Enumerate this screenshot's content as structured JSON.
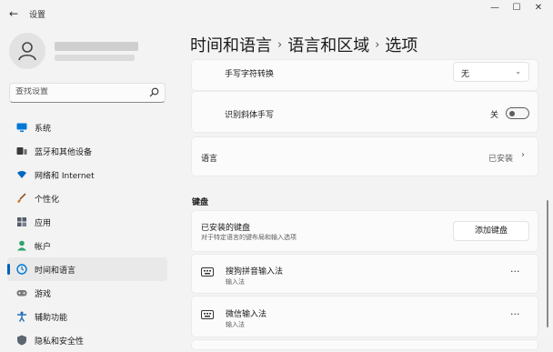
{
  "window": {
    "title": "设置",
    "back_icon": "back-arrow-icon",
    "controls": {
      "minimize": "—",
      "maximize": "☐",
      "close": "✕"
    }
  },
  "search": {
    "placeholder": "查找设置"
  },
  "nav": {
    "items": [
      {
        "label": "系统",
        "icon": "monitor-icon",
        "color": "#0078d4"
      },
      {
        "label": "蓝牙和其他设备",
        "icon": "bluetooth-devices-icon",
        "color": "#3a3a3a"
      },
      {
        "label": "网络和 Internet",
        "icon": "wifi-icon",
        "color": "#0067c0"
      },
      {
        "label": "个性化",
        "icon": "brush-icon",
        "color": "#c0662c"
      },
      {
        "label": "应用",
        "icon": "apps-icon",
        "color": "#555d6b"
      },
      {
        "label": "帐户",
        "icon": "account-icon",
        "color": "#2aa46c"
      },
      {
        "label": "时间和语言",
        "icon": "globe-clock-icon",
        "color": "#0078d4",
        "active": true
      },
      {
        "label": "游戏",
        "icon": "gamepad-icon",
        "color": "#6b6b6b"
      },
      {
        "label": "辅助功能",
        "icon": "accessibility-icon",
        "color": "#1f6fb8"
      },
      {
        "label": "隐私和安全性",
        "icon": "shield-icon",
        "color": "#5b6670"
      }
    ]
  },
  "breadcrumb": {
    "items": [
      "时间和语言",
      "语言和区域",
      "选项"
    ],
    "separator": "›"
  },
  "handwriting": {
    "label": "手写字符转换",
    "value": "无"
  },
  "italic": {
    "label": "识别斜体手写",
    "state_label": "关",
    "enabled": false
  },
  "language": {
    "label": "语言",
    "status": "已安装"
  },
  "keyboard_section": {
    "header": "键盘",
    "installed_title": "已安装的键盘",
    "installed_subtitle": "对于特定语言的键布局和输入选项",
    "add_button": "添加键盘",
    "keyboards": [
      {
        "name": "搜狗拼音输入法",
        "type": "输入法"
      },
      {
        "name": "微信输入法",
        "type": "输入法"
      }
    ],
    "more_label": "···"
  },
  "colors": {
    "accent": "#005fb8",
    "background": "#f3f3f3",
    "card": "#fbfbfb"
  }
}
